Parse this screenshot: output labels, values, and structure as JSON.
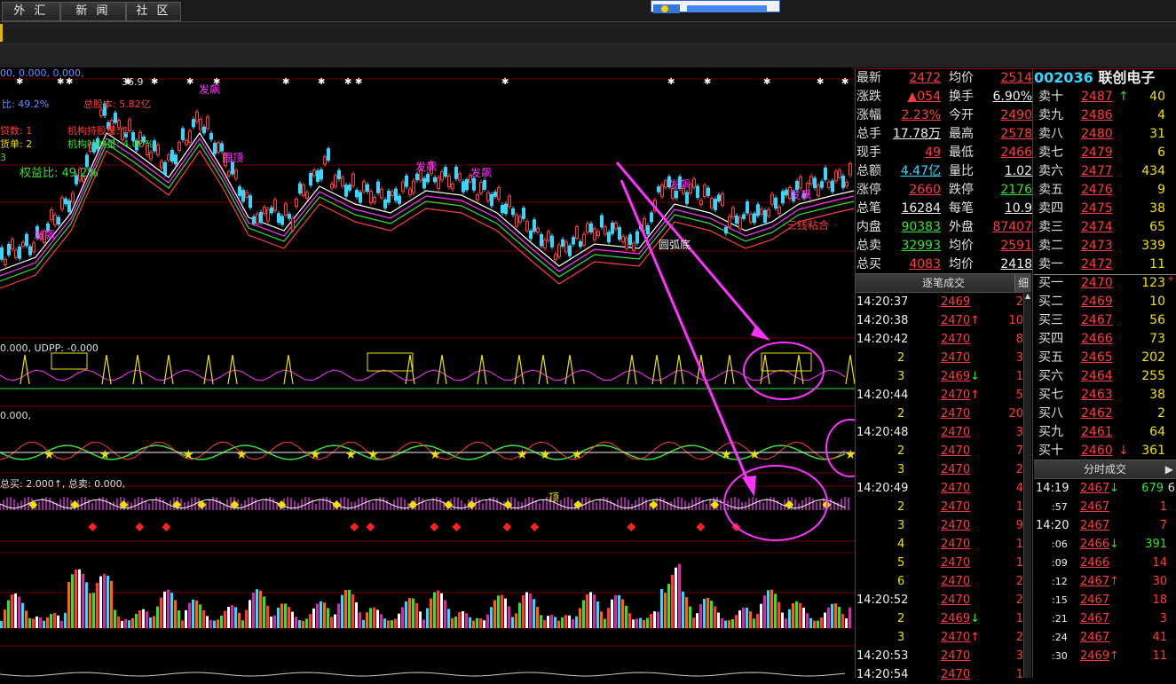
{
  "menu": {
    "forex": "外 汇",
    "news": "新 闻",
    "community": "社 区"
  },
  "stock": {
    "code": "002036",
    "name": "联创电子"
  },
  "chart_labels": {
    "main_top": "00, 0.000, 0.000,",
    "ratio": "比: 49.2%",
    "total_share": "总股本: 5.82亿",
    "loan_count": "贷数: 1",
    "loan_single": "货单: 2",
    "inst_total": "机构持股量: 1",
    "inst_trade": "机构吐纳量: 4.00%",
    "equity_ratio": "权益比: 49.2%",
    "three": "3",
    "peak": "36.9",
    "fapiao1": "发飙",
    "fapiao2": "发飙",
    "fapiao3": "发飙",
    "fapiao4": "发飙",
    "fapiao5": "发飙",
    "fapiao6": "发飙",
    "yuanding": "圆顶",
    "yuanhu": "圆弧底",
    "sanxian": "三线粘合",
    "ind1": "0.000, UDPP: -0.000",
    "ind2": "0.000,",
    "ind3": "总买: 2.000↑, 总卖: 0.000,",
    "xiao": "顶"
  },
  "quote": {
    "rows": [
      {
        "l1": "最新",
        "v1": "2472",
        "c1": "red",
        "l2": "均价",
        "v2": "2514",
        "c2": "red"
      },
      {
        "l1": "涨跌",
        "v1": "▲054",
        "c1": "red",
        "l2": "换手",
        "v2": "6.90%",
        "c2": "wht"
      },
      {
        "l1": "涨幅",
        "v1": "2.23%",
        "c1": "red",
        "l2": "今开",
        "v2": "2490",
        "c2": "red"
      },
      {
        "l1": "总手",
        "v1": "17.78万",
        "c1": "wht",
        "l2": "最高",
        "v2": "2578",
        "c2": "red"
      },
      {
        "l1": "现手",
        "v1": "49",
        "c1": "red",
        "l2": "最低",
        "v2": "2466",
        "c2": "red"
      },
      {
        "l1": "总额",
        "v1": "4.47亿",
        "c1": "cyn",
        "l2": "量比",
        "v2": "1.02",
        "c2": "wht"
      },
      {
        "l1": "涨停",
        "v1": "2660",
        "c1": "red",
        "l2": "跌停",
        "v2": "2176",
        "c2": "grn"
      },
      {
        "l1": "总笔",
        "v1": "16284",
        "c1": "wht",
        "l2": "每笔",
        "v2": "10.9",
        "c2": "wht"
      },
      {
        "l1": "内盘",
        "v1": "90383",
        "c1": "grn",
        "l2": "外盘",
        "v2": "87407",
        "c2": "red"
      },
      {
        "l1": "总卖",
        "v1": "32993",
        "c1": "grn",
        "l2": "均价",
        "v2": "2591",
        "c2": "red"
      },
      {
        "l1": "总买",
        "v1": "4083",
        "c1": "red",
        "l2": "均价",
        "v2": "2418",
        "c2": "wht"
      }
    ]
  },
  "book": {
    "rows": [
      {
        "label": "卖十",
        "price": "2487",
        "arrow": "↑",
        "vol": "40"
      },
      {
        "label": "卖九",
        "price": "2486",
        "arrow": "",
        "vol": "4"
      },
      {
        "label": "卖八",
        "price": "2480",
        "arrow": "",
        "vol": "31"
      },
      {
        "label": "卖七",
        "price": "2479",
        "arrow": "",
        "vol": "6"
      },
      {
        "label": "卖六",
        "price": "2477",
        "arrow": "",
        "vol": "434"
      },
      {
        "label": "卖五",
        "price": "2476",
        "arrow": "",
        "vol": "9"
      },
      {
        "label": "卖四",
        "price": "2475",
        "arrow": "",
        "vol": "38"
      },
      {
        "label": "卖三",
        "price": "2474",
        "arrow": "",
        "vol": "65"
      },
      {
        "label": "卖二",
        "price": "2473",
        "arrow": "",
        "vol": "339"
      },
      {
        "label": "卖一",
        "price": "2472",
        "arrow": "",
        "vol": "11"
      },
      {
        "label": "买一",
        "price": "2470",
        "arrow": "",
        "vol": "123"
      },
      {
        "label": "买二",
        "price": "2469",
        "arrow": "",
        "vol": "10"
      },
      {
        "label": "买三",
        "price": "2467",
        "arrow": "",
        "vol": "56"
      },
      {
        "label": "买四",
        "price": "2466",
        "arrow": "",
        "vol": "73"
      },
      {
        "label": "买五",
        "price": "2465",
        "arrow": "",
        "vol": "202"
      },
      {
        "label": "买六",
        "price": "2464",
        "arrow": "",
        "vol": "255"
      },
      {
        "label": "买七",
        "price": "2463",
        "arrow": "",
        "vol": "38"
      },
      {
        "label": "买八",
        "price": "2462",
        "arrow": "",
        "vol": "2"
      },
      {
        "label": "买九",
        "price": "2461",
        "arrow": "",
        "vol": "64"
      },
      {
        "label": "买十",
        "price": "2460",
        "arrow": "↓",
        "vol": "361"
      }
    ],
    "side_note": "+1"
  },
  "tick_panel": {
    "title": "逐笔成交",
    "detail_btn": "细",
    "rows": [
      {
        "t": "14:20:37",
        "p": "2469",
        "a": "",
        "v": "2"
      },
      {
        "t": "14:20:38",
        "p": "2470",
        "a": "↑",
        "v": "10"
      },
      {
        "t": "14:20:42",
        "p": "2470",
        "a": "",
        "v": "8"
      },
      {
        "t": "2",
        "p": "2470",
        "a": "",
        "v": "3"
      },
      {
        "t": "3",
        "p": "2469",
        "a": "↓",
        "v": "1"
      },
      {
        "t": "14:20:44",
        "p": "2470",
        "a": "↑",
        "v": "5"
      },
      {
        "t": "2",
        "p": "2470",
        "a": "",
        "v": "20"
      },
      {
        "t": "14:20:48",
        "p": "2470",
        "a": "",
        "v": "3"
      },
      {
        "t": "2",
        "p": "2470",
        "a": "",
        "v": "7"
      },
      {
        "t": "3",
        "p": "2470",
        "a": "",
        "v": "2"
      },
      {
        "t": "14:20:49",
        "p": "2470",
        "a": "",
        "v": "4"
      },
      {
        "t": "2",
        "p": "2470",
        "a": "",
        "v": "1"
      },
      {
        "t": "3",
        "p": "2470",
        "a": "",
        "v": "9"
      },
      {
        "t": "4",
        "p": "2470",
        "a": "",
        "v": "1"
      },
      {
        "t": "5",
        "p": "2470",
        "a": "",
        "v": "1"
      },
      {
        "t": "6",
        "p": "2470",
        "a": "",
        "v": "2"
      },
      {
        "t": "14:20:52",
        "p": "2470",
        "a": "",
        "v": "2"
      },
      {
        "t": "2",
        "p": "2469",
        "a": "↓",
        "v": "1"
      },
      {
        "t": "3",
        "p": "2470",
        "a": "↑",
        "v": "2"
      },
      {
        "t": "14:20:53",
        "p": "2470",
        "a": "",
        "v": "3"
      },
      {
        "t": "14:20:54",
        "p": "2470",
        "a": "",
        "v": "1"
      }
    ]
  },
  "minute_panel": {
    "title": "分时成交",
    "rows": [
      {
        "t": "14:19",
        "p": "2467",
        "a": "↓",
        "v": "679",
        "x": "6"
      },
      {
        "t": ":57",
        "p": "2467",
        "a": "",
        "v": "1",
        "x": ""
      },
      {
        "t": "14:20",
        "p": "2467",
        "a": "",
        "v": "7",
        "x": ""
      },
      {
        "t": ":06",
        "p": "2466",
        "a": "↓",
        "v": "391",
        "x": ""
      },
      {
        "t": ":09",
        "p": "2466",
        "a": "",
        "v": "14",
        "x": ""
      },
      {
        "t": ":12",
        "p": "2467",
        "a": "↑",
        "v": "30",
        "x": ""
      },
      {
        "t": ":15",
        "p": "2467",
        "a": "",
        "v": "18",
        "x": ""
      },
      {
        "t": ":21",
        "p": "2467",
        "a": "",
        "v": "3",
        "x": ""
      },
      {
        "t": ":24",
        "p": "2467",
        "a": "",
        "v": "41",
        "x": ""
      },
      {
        "t": ":30",
        "p": "2469",
        "a": "↑",
        "v": "11",
        "x": ""
      }
    ]
  },
  "colors": {
    "up": "#ff3b3b",
    "down": "#33e033",
    "accent": "#ff33ff",
    "grid": "#8b0000"
  }
}
